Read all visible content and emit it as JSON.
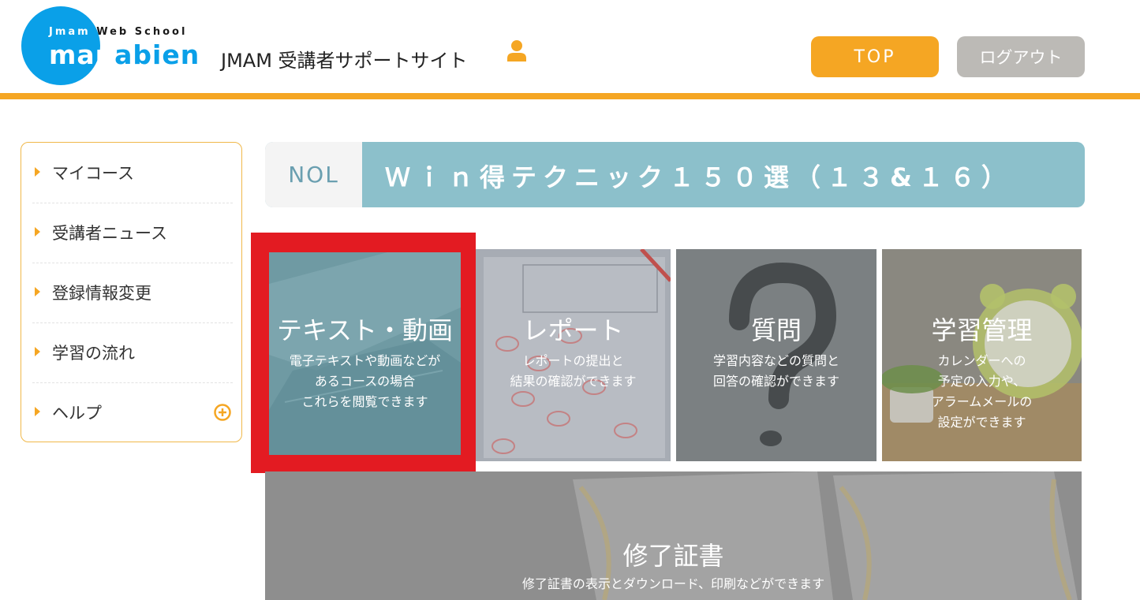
{
  "header": {
    "logo": {
      "tagline": "Jmam Web School",
      "name": "manabien"
    },
    "site_title": "JMAM 受講者サポートサイト",
    "top_button": "TOP",
    "logout_button": "ログアウト"
  },
  "sidebar": {
    "items": [
      {
        "label": "マイコース"
      },
      {
        "label": "受講者ニュース"
      },
      {
        "label": "登録情報変更"
      },
      {
        "label": "学習の流れ"
      },
      {
        "label": "ヘルプ"
      }
    ]
  },
  "course": {
    "prefix": "NOL",
    "title": "Ｗｉｎ得テクニック１５０選（１３&１６）"
  },
  "tiles": [
    {
      "title": "テキスト・動画",
      "desc": [
        "電子テキストや動画などが",
        "あるコースの場合",
        "これらを閲覧できます"
      ],
      "highlighted": true
    },
    {
      "title": "レポート",
      "desc": [
        "レポートの提出と",
        "結果の確認ができます"
      ]
    },
    {
      "title": "質問",
      "desc": [
        "学習内容などの質問と",
        "回答の確認ができます"
      ]
    },
    {
      "title": "学習管理",
      "desc": [
        "カレンダーへの",
        "予定の入力や、",
        "アラームメールの",
        "設定ができます"
      ]
    },
    {
      "title": "修了証書",
      "desc": [
        "修了証書の表示とダウンロード、印刷などができます"
      ]
    }
  ],
  "colors": {
    "accent": "#f5a623",
    "logo_blue": "#0aa0e8",
    "course_bar": "#8cc0cb",
    "highlight_frame": "#e31b22",
    "logout_gray": "#bcbab6"
  }
}
